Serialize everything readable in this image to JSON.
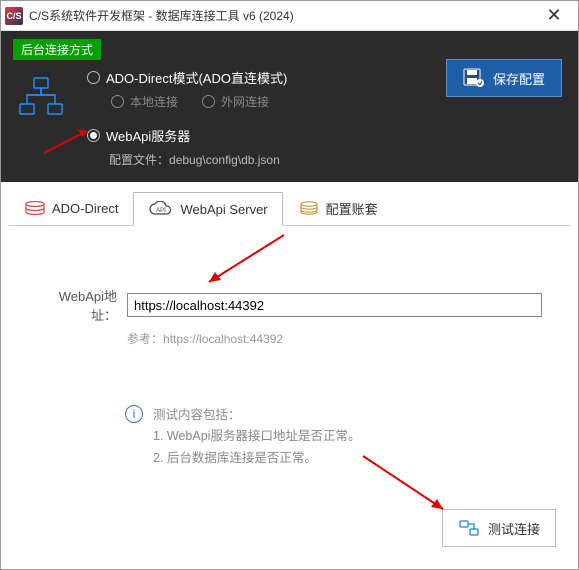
{
  "window": {
    "title": "C/S系统软件开发框架 - 数据库连接工具 v6 (2024)",
    "appIcon": "C/S"
  },
  "darkPanel": {
    "badge": "后台连接方式",
    "option1": "ADO-Direct模式(ADO直连模式)",
    "sub1": "本地连接",
    "sub2": "外网连接",
    "option2": "WebApi服务器",
    "configLabel": "配置文件：",
    "configPath": "debug\\config\\db.json",
    "saveBtn": "保存配置"
  },
  "tabs": {
    "t1": "ADO-Direct",
    "t2": "WebApi Server",
    "t3": "配置账套"
  },
  "form": {
    "addrLabel": "WebApi地址：",
    "addrValue": "https://localhost:44392",
    "hintPrefix": "参考：",
    "hintValue": "https://localhost:44392"
  },
  "info": {
    "header": "测试内容包括：",
    "line1": "1. WebApi服务器接口地址是否正常。",
    "line2": "2. 后台数据库连接是否正常。"
  },
  "testBtn": "测试连接"
}
